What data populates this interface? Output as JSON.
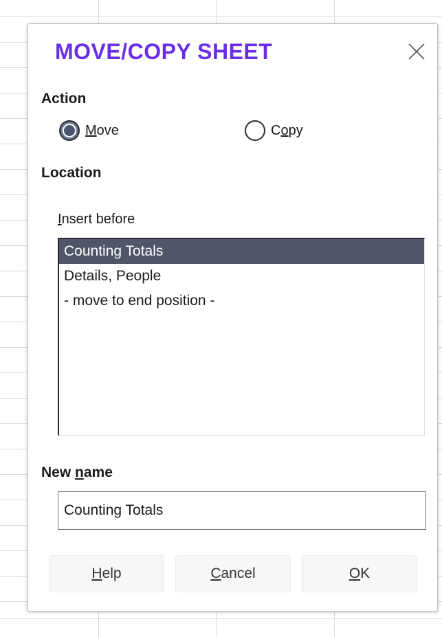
{
  "dialog": {
    "title": "MOVE/COPY SHEET",
    "close_icon": "close-icon",
    "accent_color": "#6a2ee6"
  },
  "action": {
    "heading": "Action",
    "options": [
      {
        "label_first": "M",
        "label_rest": "ove",
        "checked": true
      },
      {
        "label_first": "C",
        "label_mid": "o",
        "label_rest": "py",
        "checked": false
      }
    ]
  },
  "location": {
    "heading": "Location",
    "insert_before_first": "I",
    "insert_before_rest": "nsert before",
    "items": [
      "Counting Totals",
      "Details, People",
      "- move to end position -"
    ],
    "selected_index": 0
  },
  "new_name": {
    "label_pre": "New ",
    "label_u": "n",
    "label_post": "ame",
    "value": "Counting Totals"
  },
  "buttons": {
    "help_u": "H",
    "help_rest": "elp",
    "cancel_u": "C",
    "cancel_rest": "ancel",
    "ok_u": "O",
    "ok_rest": "K"
  }
}
